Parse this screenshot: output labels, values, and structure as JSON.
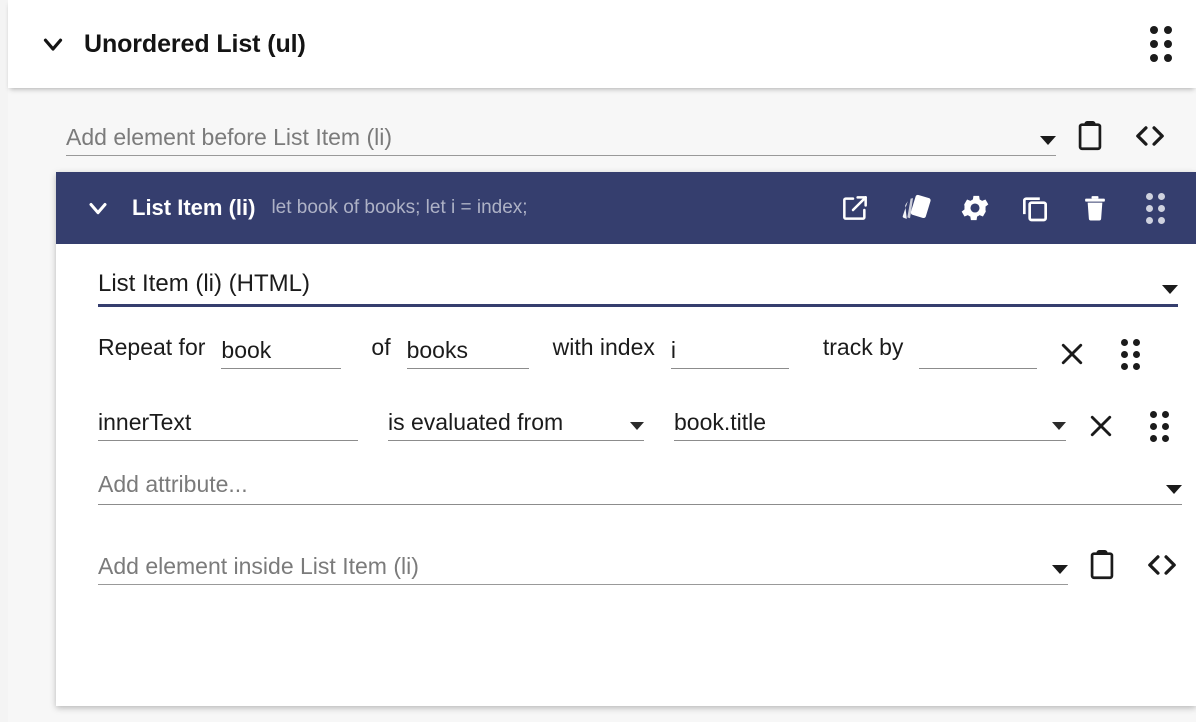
{
  "outer": {
    "title": "Unordered List (ul)",
    "chevron_icon": "chevron-down-icon",
    "drag_icon": "drag-handle-icon",
    "add_before": {
      "placeholder": "Add element before List Item (li)",
      "dropdown_icon": "chevron-down-icon",
      "paste_icon": "clipboard-icon",
      "code_icon": "code-brackets-icon"
    }
  },
  "li": {
    "chevron_icon": "chevron-down-icon",
    "name": "List Item (li)",
    "subtitle": "let book of books; let i = index;",
    "toolbar": [
      {
        "name": "open-external-icon",
        "label": "Open in new window"
      },
      {
        "name": "style-palette-icon",
        "label": "Styles"
      },
      {
        "name": "gear-icon",
        "label": "Settings"
      },
      {
        "name": "copy-icon",
        "label": "Duplicate"
      },
      {
        "name": "trash-icon",
        "label": "Delete"
      },
      {
        "name": "drag-handle-icon",
        "label": "Reorder"
      }
    ],
    "type_select": {
      "value": "List Item (li) (HTML)",
      "dropdown_icon": "chevron-down-icon"
    },
    "repeat": {
      "label_repeat_for": "Repeat for",
      "item_value": "book",
      "label_of": "of",
      "collection_value": "books",
      "label_with_index": "with index",
      "index_value": "i",
      "label_track_by": "track by",
      "track_by_value": "",
      "remove_icon": "close-x-icon",
      "drag_icon": "drag-handle-icon"
    },
    "binding": {
      "property_value": "innerText",
      "operator_value": "is evaluated from",
      "operator_dropdown_icon": "chevron-down-icon",
      "expression_value": "book.title",
      "expression_dropdown_icon": "chevron-down-icon",
      "remove_icon": "close-x-icon",
      "drag_icon": "drag-handle-icon"
    },
    "add_attribute": {
      "placeholder": "Add attribute...",
      "dropdown_icon": "chevron-down-icon"
    },
    "add_inside": {
      "placeholder": "Add element inside List Item (li)",
      "dropdown_icon": "chevron-down-icon",
      "paste_icon": "clipboard-icon",
      "code_icon": "code-brackets-icon"
    }
  },
  "colors": {
    "accent": "#353e6e",
    "page_bg": "#f4f4f4",
    "card_bg": "#ffffff",
    "muted_text": "#7b7b7b",
    "subtitle_text": "#aeb2c6",
    "underline": "#8c8c8c"
  }
}
